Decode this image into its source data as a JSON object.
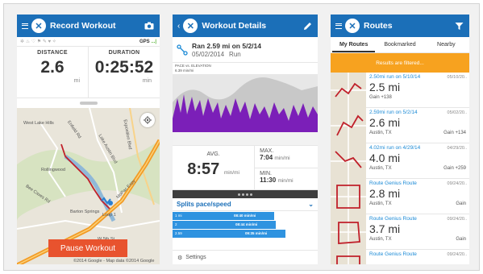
{
  "record": {
    "title": "Record Workout",
    "gps_label": "GPS",
    "gps_signal": "...|",
    "distance_label": "DISTANCE",
    "distance_value": "2.6",
    "distance_unit": "mi",
    "duration_label": "DURATION",
    "duration_value": "0:25:52",
    "duration_unit": "min",
    "pause_label": "Pause Workout",
    "map_copyright": "©2014 Google - Map data ©2014 Google",
    "map_labels": [
      "West Lake Hills",
      "Rollingwood",
      "Bee Caves Rd",
      "Lake Austin Blvd",
      "Enfield Rd",
      "Exposition Blvd",
      "W 5th St",
      "Barton Springs",
      "MoPac Expy",
      "Loop 1"
    ]
  },
  "details": {
    "title": "Workout Details",
    "run_title": "Ran 2.59 mi on 5/2/14",
    "run_date": "05/02/2014",
    "run_type": "Run",
    "graph_caption": "PACE vs. ELEVATION",
    "graph_value": "6.39 min/mi",
    "avg_label": "AVG.",
    "avg_value": "8:57",
    "avg_unit": "min/mi",
    "max_label": "MAX.",
    "max_value": "7:04",
    "max_unit": "min/mi",
    "min_label": "MIN.",
    "min_value": "11:30",
    "min_unit": "min/mi",
    "splits_label": "Splits pace/speed",
    "splits": [
      {
        "n": "1 mi",
        "time": "08:40 min/mi",
        "fill": 0.7
      },
      {
        "n": "2",
        "time": "08:44 min/mi",
        "fill": 0.71
      },
      {
        "n": "2.59",
        "time": "09:35 min/mi",
        "fill": 0.78
      }
    ],
    "settings_label": "Settings"
  },
  "routes": {
    "title": "Routes",
    "tabs": [
      "My Routes",
      "Bookmarked",
      "Nearby"
    ],
    "filter_notice": "Results are filtered...",
    "items": [
      {
        "title": "2.50mi run on 5/10/14",
        "date": "05/10/20..",
        "dist": "2.5 mi",
        "loc": "Gain +138",
        "gain": ""
      },
      {
        "title": "2.59mi run on 5/2/14",
        "date": "05/02/20..",
        "dist": "2.6 mi",
        "loc": "Austin, TX",
        "gain": "Gain +134"
      },
      {
        "title": "4.02mi run on 4/29/14",
        "date": "04/29/20..",
        "dist": "4.0 mi",
        "loc": "Austin, TX",
        "gain": "Gain +259"
      },
      {
        "title": "Route Genius Route",
        "date": "09/24/20..",
        "dist": "2.8 mi",
        "loc": "Austin, TX",
        "gain": "Gain"
      },
      {
        "title": "Route Genius Route",
        "date": "09/24/20..",
        "dist": "3.7 mi",
        "loc": "Austin, TX",
        "gain": "Gain"
      },
      {
        "title": "Route Genius Route",
        "date": "09/24/20..",
        "dist": "",
        "loc": "",
        "gain": ""
      }
    ]
  },
  "colors": {
    "brand": "#1b6fb8",
    "pause": "#e8532e",
    "accent_orange": "#f7a21f",
    "elevation_purple": "#7b1fb8"
  }
}
